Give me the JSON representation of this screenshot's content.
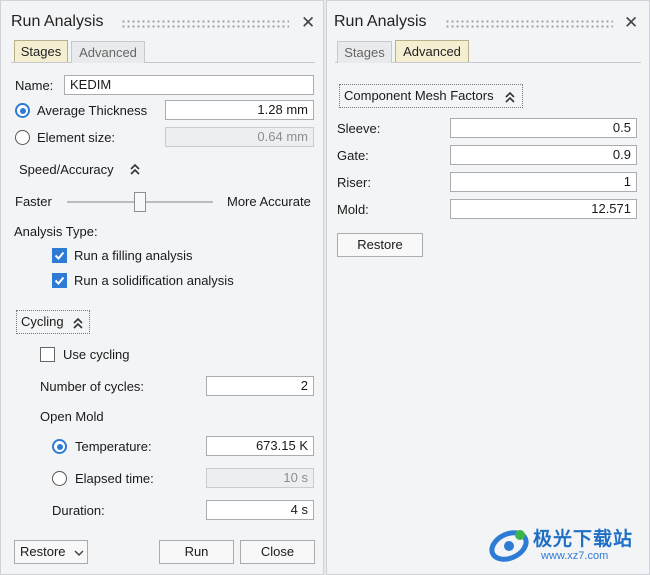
{
  "left": {
    "title": "Run Analysis",
    "tabs": [
      "Stages",
      "Advanced"
    ],
    "name_label": "Name:",
    "name_value": "KEDIM",
    "avg_thickness_label": "Average Thickness",
    "avg_thickness_value": "1.28 mm",
    "element_size_label": "Element size:",
    "element_size_value": "0.64 mm",
    "speed_accuracy_label": "Speed/Accuracy",
    "slider_left_label": "Faster",
    "slider_right_label": "More Accurate",
    "slider_level": 0.5,
    "analysis_type_label": "Analysis Type:",
    "run_filling_label": "Run a filling analysis",
    "run_solidification_label": "Run a solidification analysis",
    "cycling_label": "Cycling",
    "use_cycling_label": "Use cycling",
    "cycles_label": "Number of cycles:",
    "cycles_value": "2",
    "open_mold_label": "Open Mold",
    "temperature_label": "Temperature:",
    "temperature_value": "673.15 K",
    "elapsed_label": "Elapsed time:",
    "elapsed_value": "10 s",
    "duration_label": "Duration:",
    "duration_value": "4 s",
    "restore_label": "Restore",
    "run_label": "Run",
    "close_label": "Close"
  },
  "right": {
    "title": "Run Analysis",
    "tabs": [
      "Stages",
      "Advanced"
    ],
    "mesh_factors_label": "Component Mesh Factors",
    "sleeve_label": "Sleeve:",
    "sleeve_value": "0.5",
    "gate_label": "Gate:",
    "gate_value": "0.9",
    "riser_label": "Riser:",
    "riser_value": "1",
    "mold_label": "Mold:",
    "mold_value": "12.571",
    "restore_label": "Restore"
  },
  "watermark": {
    "text": "极光下载站",
    "url": "www.xz7.com"
  },
  "icons": {
    "close": "close-icon",
    "collapse": "chevron-double-up-icon",
    "dropdown": "chevron-down-icon"
  },
  "colors": {
    "accent": "#2e7bd6",
    "active_tab": "#f5efd2",
    "panel_bg": "#f3f4f6"
  }
}
